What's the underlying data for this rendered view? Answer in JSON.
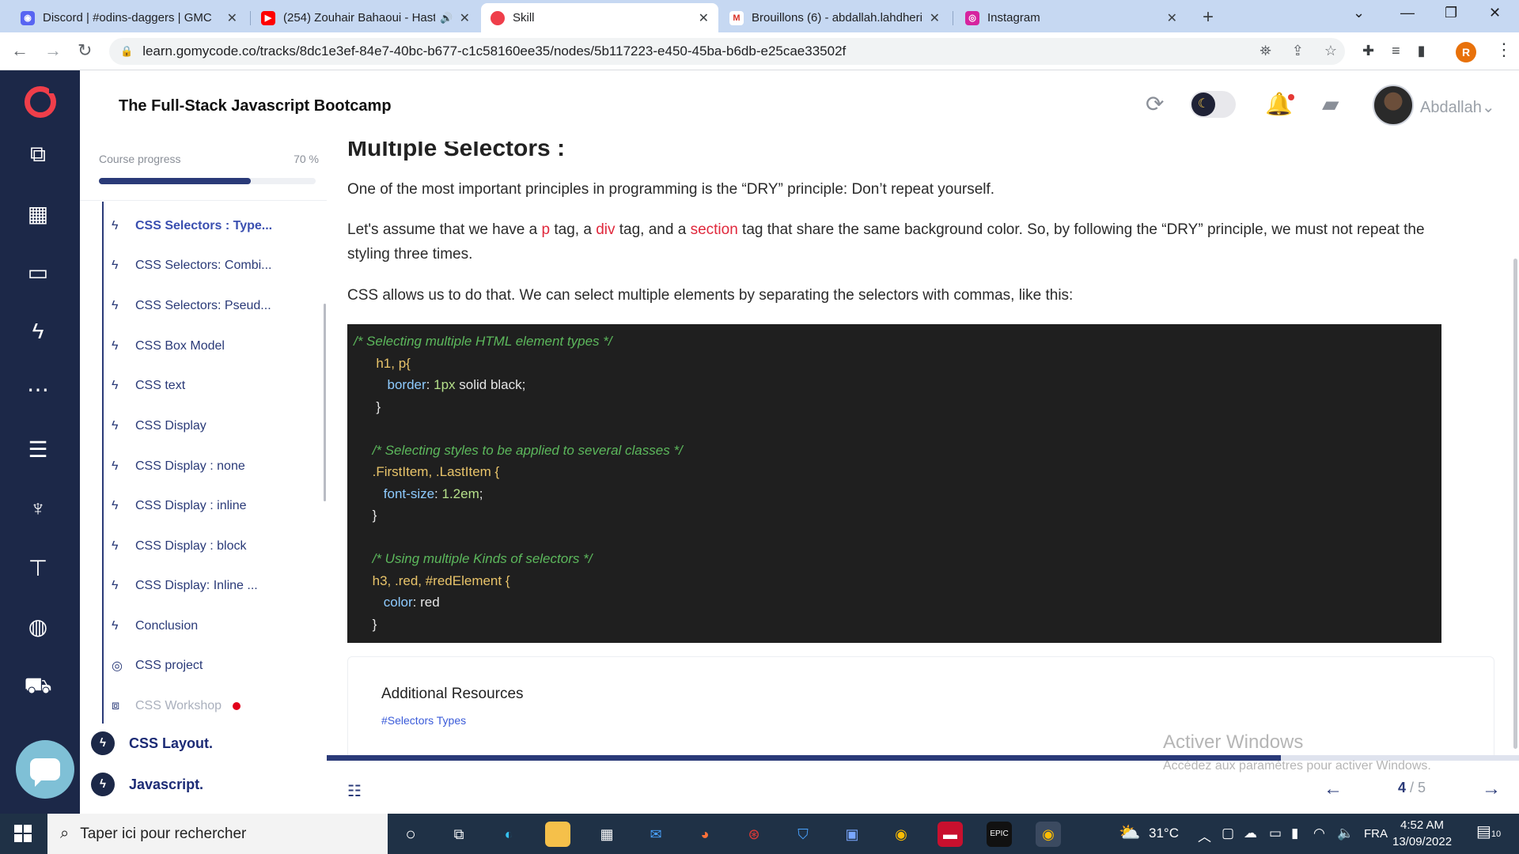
{
  "browser": {
    "tabs": [
      {
        "title": "Discord | #odins-daggers | GMC"
      },
      {
        "title": "(254) Zouhair Bahaoui - Hast"
      },
      {
        "title": "Skill"
      },
      {
        "title": "Brouillons (6) - abdallah.lahdheri"
      },
      {
        "title": "Instagram"
      }
    ],
    "url": "learn.gomycode.co/tracks/8dc1e3ef-84e7-40bc-b677-c1c58160ee35/nodes/5b117223-e450-45ba-b6db-e25cae33502f",
    "profile_initial": "R"
  },
  "header": {
    "course_title": "The Full-Stack Javascript Bootcamp",
    "username": "Abdallah"
  },
  "sidebar": {
    "progress_label": "Course progress",
    "progress_text": "70 %",
    "progress_value": 0.7,
    "lessons": [
      {
        "label": "CSS Selectors : Type...",
        "icon": "bolt-icon"
      },
      {
        "label": "CSS Selectors: Combi...",
        "icon": "bolt-icon"
      },
      {
        "label": "CSS Selectors: Pseud...",
        "icon": "bolt-icon"
      },
      {
        "label": "CSS Box Model",
        "icon": "bolt-icon"
      },
      {
        "label": "CSS text",
        "icon": "bolt-icon"
      },
      {
        "label": "CSS Display",
        "icon": "bolt-icon"
      },
      {
        "label": "CSS Display : none",
        "icon": "bolt-icon"
      },
      {
        "label": "CSS Display : inline",
        "icon": "bolt-icon"
      },
      {
        "label": "CSS Display : block",
        "icon": "bolt-icon"
      },
      {
        "label": "CSS Display: Inline ...",
        "icon": "bolt-icon"
      },
      {
        "label": "Conclusion",
        "icon": "bolt-icon"
      },
      {
        "label": "CSS project",
        "icon": "target-icon"
      },
      {
        "label": "CSS Workshop",
        "icon": "workshop-icon"
      }
    ],
    "modules": [
      {
        "label": "CSS Layout."
      },
      {
        "label": "Javascript."
      }
    ]
  },
  "content": {
    "heading": "Multiple Selectors :",
    "para1": "One of the most important principles in programming is the “DRY” principle: Don’t repeat yourself.",
    "para2": {
      "t1": "Let's assume that we have a ",
      "tag1": "p",
      "t2": " tag, a ",
      "tag2": "div",
      "t3": " tag, and a ",
      "tag3": "section",
      "t4": " tag that share the same background color. So, by following the “DRY” principle, we must not repeat the styling three times."
    },
    "para3": "CSS allows us to do that. We can select multiple elements by separating the selectors with commas, like this:",
    "code": {
      "c1": "/* Selecting multiple HTML element types */",
      "l2": "h1, p{",
      "l3_prop": "border",
      "l3_num": "1px",
      "l3_rest": " solid black;",
      "l4": "}",
      "c2": "/* Selecting styles to be applied to several classes */",
      "l7": ".FirstItem, .LastItem {",
      "l8_prop": "font-size",
      "l8_num": "1.2em",
      "l9": "}",
      "c3": "/* Using multiple Kinds of selectors */",
      "l12": "h3, .red, #redElement {",
      "l13_prop": "color",
      "l13_val": "red",
      "l14": "}"
    },
    "resources_title": "Additional Resources",
    "resources_link": "#Selectors Types"
  },
  "footer": {
    "page_current": "4",
    "page_total": " / 5",
    "progress_value": 0.8
  },
  "watermark": {
    "line1": "Activer Windows",
    "line2": "Accédez aux paramètres pour activer Windows."
  },
  "taskbar": {
    "search_placeholder": "Taper ici pour rechercher",
    "weather": "31°C",
    "lang": "FRA",
    "time": "4:52 AM",
    "date": "13/09/2022",
    "notif_count": "10"
  },
  "colors": {
    "rail_bg": "#1c2848",
    "accent": "#2a3a78",
    "brand": "#ef3e4a"
  }
}
